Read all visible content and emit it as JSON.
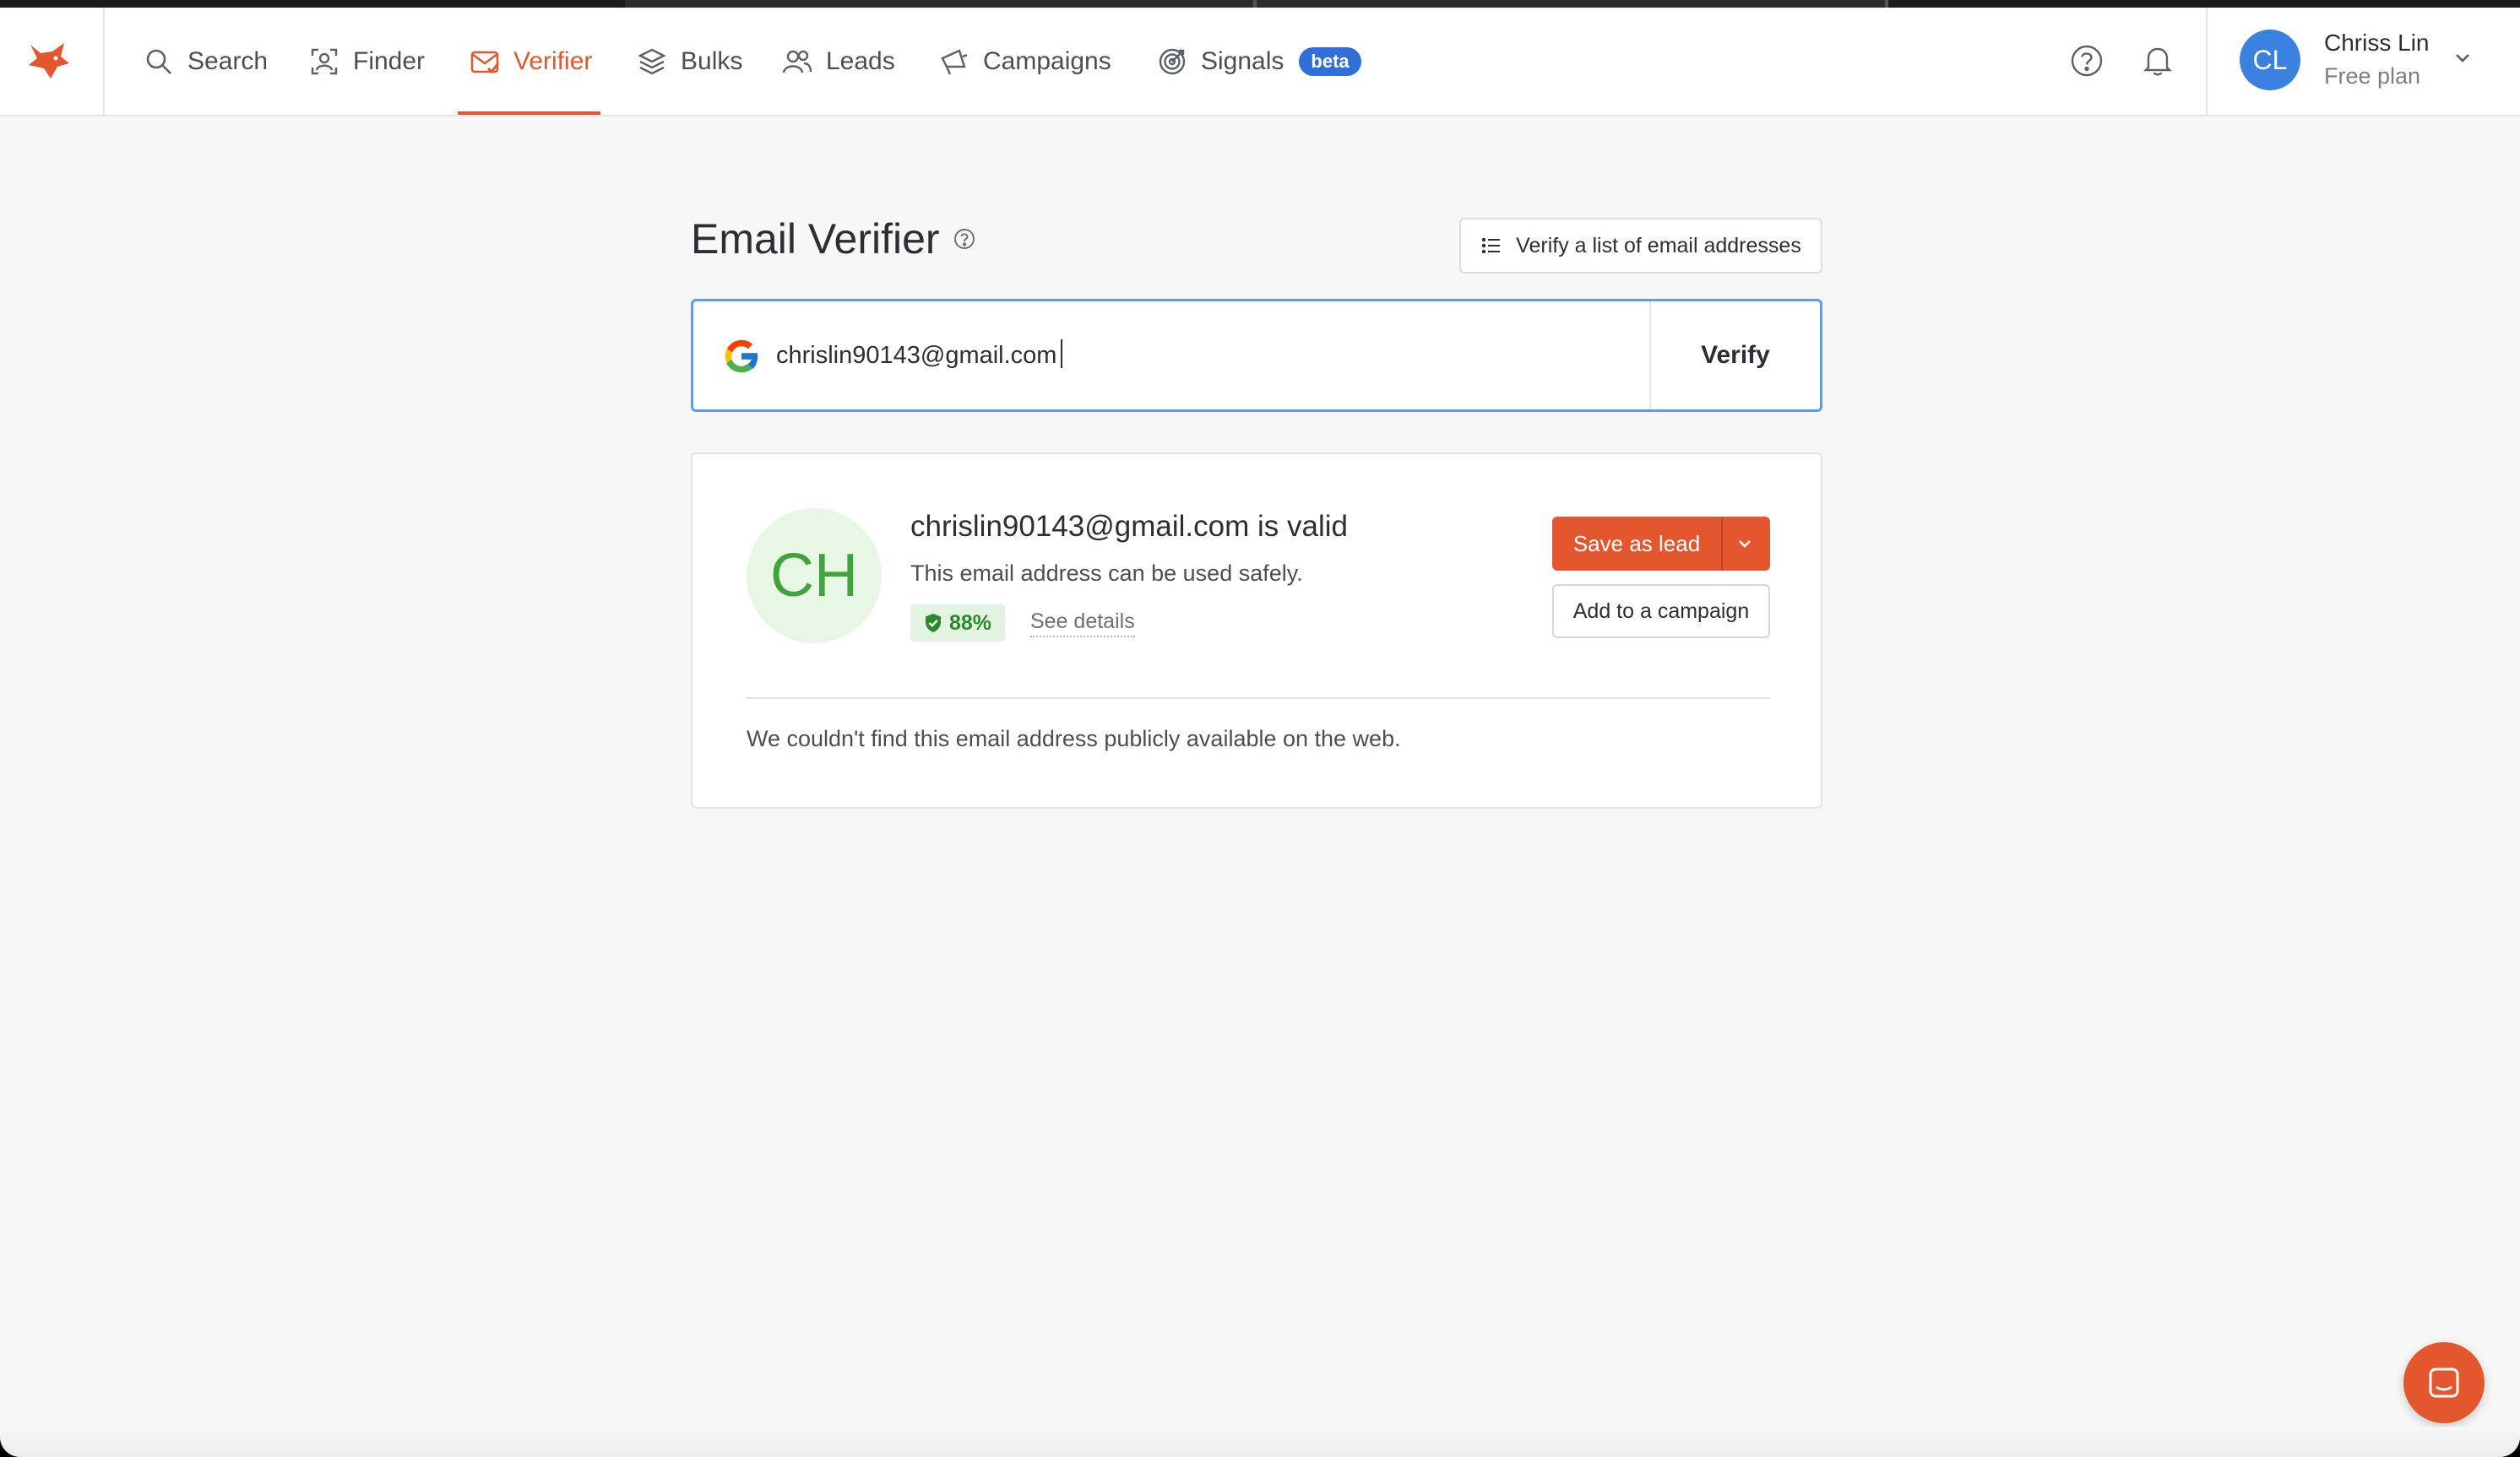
{
  "nav": {
    "items": [
      {
        "label": "Search",
        "icon": "search-icon"
      },
      {
        "label": "Finder",
        "icon": "finder-icon"
      },
      {
        "label": "Verifier",
        "icon": "verifier-icon",
        "active": true
      },
      {
        "label": "Bulks",
        "icon": "layers-icon"
      },
      {
        "label": "Leads",
        "icon": "users-icon"
      },
      {
        "label": "Campaigns",
        "icon": "megaphone-icon"
      },
      {
        "label": "Signals",
        "icon": "target-icon",
        "badge": "beta"
      }
    ],
    "accent_color": "#e4572e"
  },
  "user": {
    "initials": "CL",
    "name": "Chriss Lin",
    "plan": "Free plan"
  },
  "page": {
    "title": "Email Verifier",
    "list_button_label": "Verify a list of email addresses"
  },
  "search": {
    "value": "chrislin90143@gmail.com",
    "verify_label": "Verify"
  },
  "result": {
    "initials": "CH",
    "title": "chrislin90143@gmail.com is valid",
    "subtitle": "This email address can be used safely.",
    "score": "88%",
    "see_details": "See details",
    "save_lead_label": "Save as lead",
    "add_campaign_label": "Add to a campaign",
    "note": "We couldn't find this email address publicly available on the web."
  }
}
